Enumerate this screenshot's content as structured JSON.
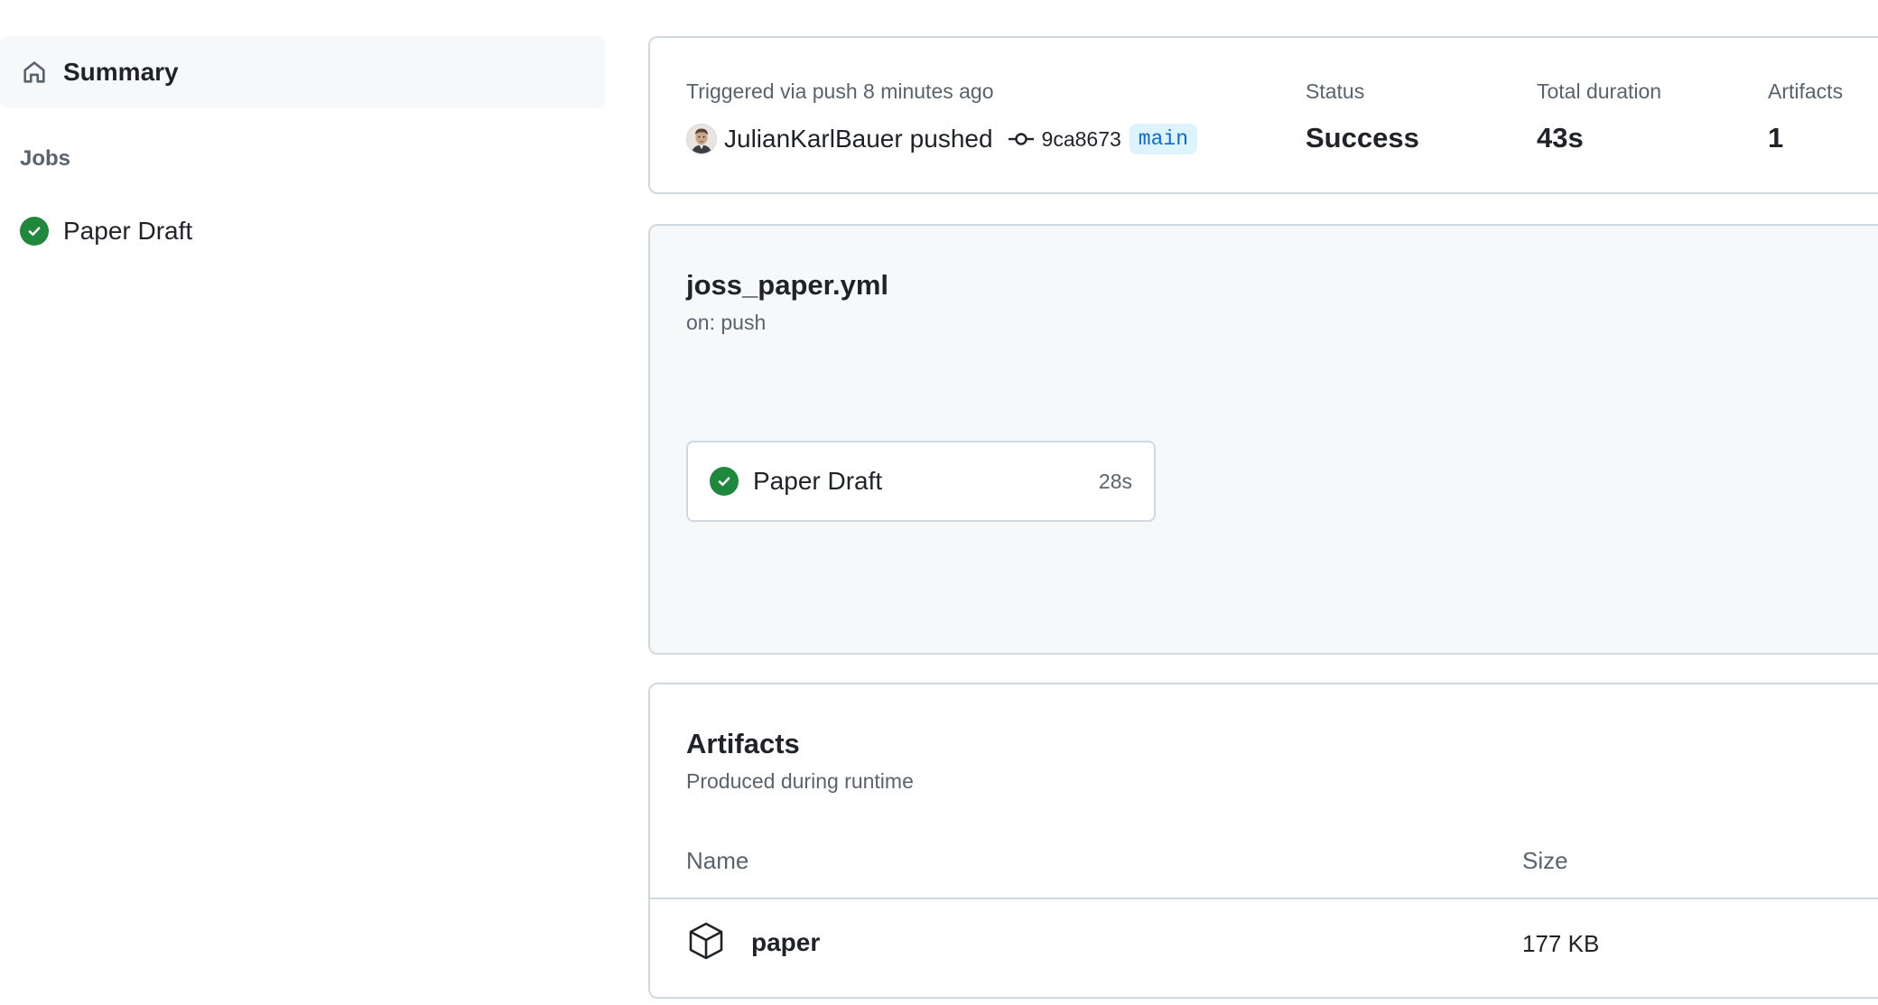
{
  "sidebar": {
    "summary_label": "Summary",
    "jobs_heading": "Jobs",
    "jobs": [
      {
        "label": "Paper Draft",
        "status": "success"
      }
    ]
  },
  "run": {
    "trigger_text": "Triggered via push 8 minutes ago",
    "pusher": "JulianKarlBauer",
    "action_word": "pushed",
    "commit_sha": "9ca8673",
    "branch": "main",
    "status_label": "Status",
    "status_value": "Success",
    "duration_label": "Total duration",
    "duration_value": "43s",
    "artifacts_label": "Artifacts",
    "artifacts_value": "1"
  },
  "workflow": {
    "file": "joss_paper.yml",
    "trigger": "on: push",
    "jobs": [
      {
        "name": "Paper Draft",
        "duration": "28s",
        "status": "success"
      }
    ]
  },
  "artifacts": {
    "title": "Artifacts",
    "subtitle": "Produced during runtime",
    "columns": {
      "name": "Name",
      "size": "Size"
    },
    "items": [
      {
        "name": "paper",
        "size": "177 KB",
        "icon": "package-icon"
      }
    ]
  },
  "colors": {
    "success": "#1f883d",
    "branch_bg": "#ddf4ff",
    "branch_fg": "#0969da",
    "muted": "#59636e",
    "border": "#d1d9e0"
  }
}
